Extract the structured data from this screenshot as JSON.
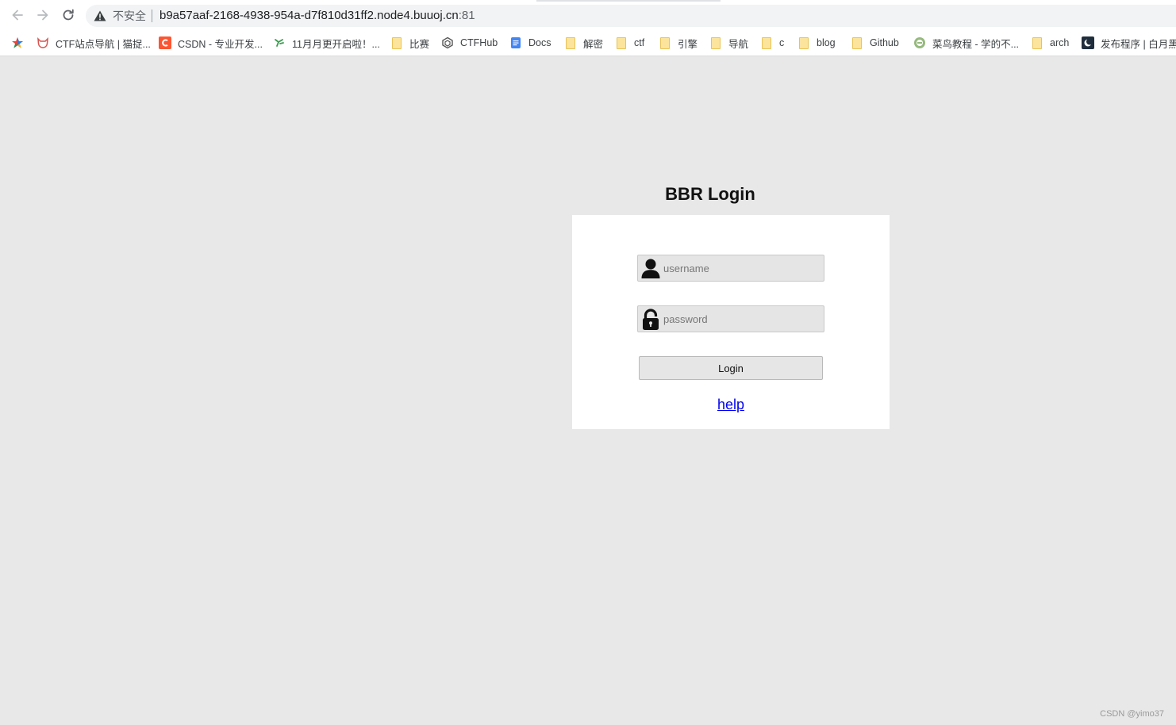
{
  "browser": {
    "insecure_label": "不安全",
    "url": "b9a57aaf-2168-4938-954a-d7f810d31ff2.node4.buuoj.cn",
    "url_port": ":81"
  },
  "bookmarks": [
    {
      "label": "",
      "icon": "colorful-star-icon"
    },
    {
      "label": "CTF站点导航 | 猫捉...",
      "icon": "cat-icon"
    },
    {
      "label": "CSDN - 专业开发...",
      "icon": "csdn-icon"
    },
    {
      "label": "11月月更开启啦！...",
      "icon": "green-leaf-icon"
    },
    {
      "label": "比赛",
      "icon": "folder-icon"
    },
    {
      "label": "CTFHub",
      "icon": "ctfhub-icon"
    },
    {
      "label": "Docs",
      "icon": "docs-icon"
    },
    {
      "label": "解密",
      "icon": "folder-icon"
    },
    {
      "label": "ctf",
      "icon": "folder-icon"
    },
    {
      "label": "引擎",
      "icon": "folder-icon"
    },
    {
      "label": "导航",
      "icon": "folder-icon"
    },
    {
      "label": "c",
      "icon": "folder-icon"
    },
    {
      "label": "blog",
      "icon": "folder-icon"
    },
    {
      "label": "Github",
      "icon": "folder-icon"
    },
    {
      "label": "菜鸟教程 - 学的不...",
      "icon": "runoob-icon"
    },
    {
      "label": "arch",
      "icon": "folder-icon"
    },
    {
      "label": "发布程序 | 白月黑",
      "icon": "moon-icon"
    }
  ],
  "page": {
    "title": "BBR Login",
    "username_placeholder": "username",
    "password_placeholder": "password",
    "login_label": "Login",
    "help_label": "help"
  },
  "watermark": "CSDN @yimo37",
  "colors": {
    "page_bg": "#e8e8e8",
    "card_bg": "#ffffff",
    "link": "#0000ee"
  }
}
